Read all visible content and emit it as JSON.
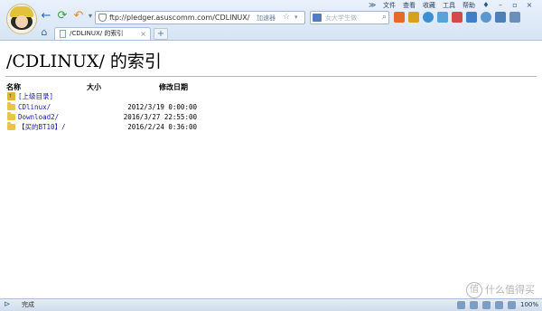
{
  "menubar": {
    "items": [
      "文件",
      "查看",
      "收藏",
      "工具",
      "帮助"
    ]
  },
  "toolbar": {
    "back": "back-icon",
    "refresh": "refresh-icon",
    "undo": "undo-icon",
    "undo_dropdown": "▾"
  },
  "address": {
    "url": "ftp://pledger.asuscomm.com/CDLINUX/",
    "accelerator": "加速器",
    "star": "☆",
    "dropdown": "▾"
  },
  "search": {
    "placeholder": "女大学生做"
  },
  "tab": {
    "title": "/CDLINUX/ 的索引",
    "close": "×",
    "new_tab": "+"
  },
  "page": {
    "heading": "/CDLINUX/ 的索引",
    "columns": {
      "name": "名称",
      "size": "大小",
      "modified": "修改日期"
    },
    "parent": "[上级目录]",
    "rows": [
      {
        "name": "CDlinux/",
        "size": "",
        "date": "2012/3/19  0:00:00"
      },
      {
        "name": "Download2/",
        "size": "",
        "date": "2016/3/27 22:55:00"
      },
      {
        "name": "【买的BT10】/",
        "size": "",
        "date": "2016/2/24  0:36:00"
      }
    ]
  },
  "status": {
    "text": "完成",
    "zoom": "100%"
  },
  "watermark": {
    "text": "什么值得买",
    "logo": "值"
  },
  "colors": {
    "chrome": "#d6e4f4",
    "link": "#1a1aa6",
    "folder": "#e8c54a",
    "back": "#2d6cc0",
    "refresh": "#3aa03a",
    "undo": "#e08a1e"
  }
}
